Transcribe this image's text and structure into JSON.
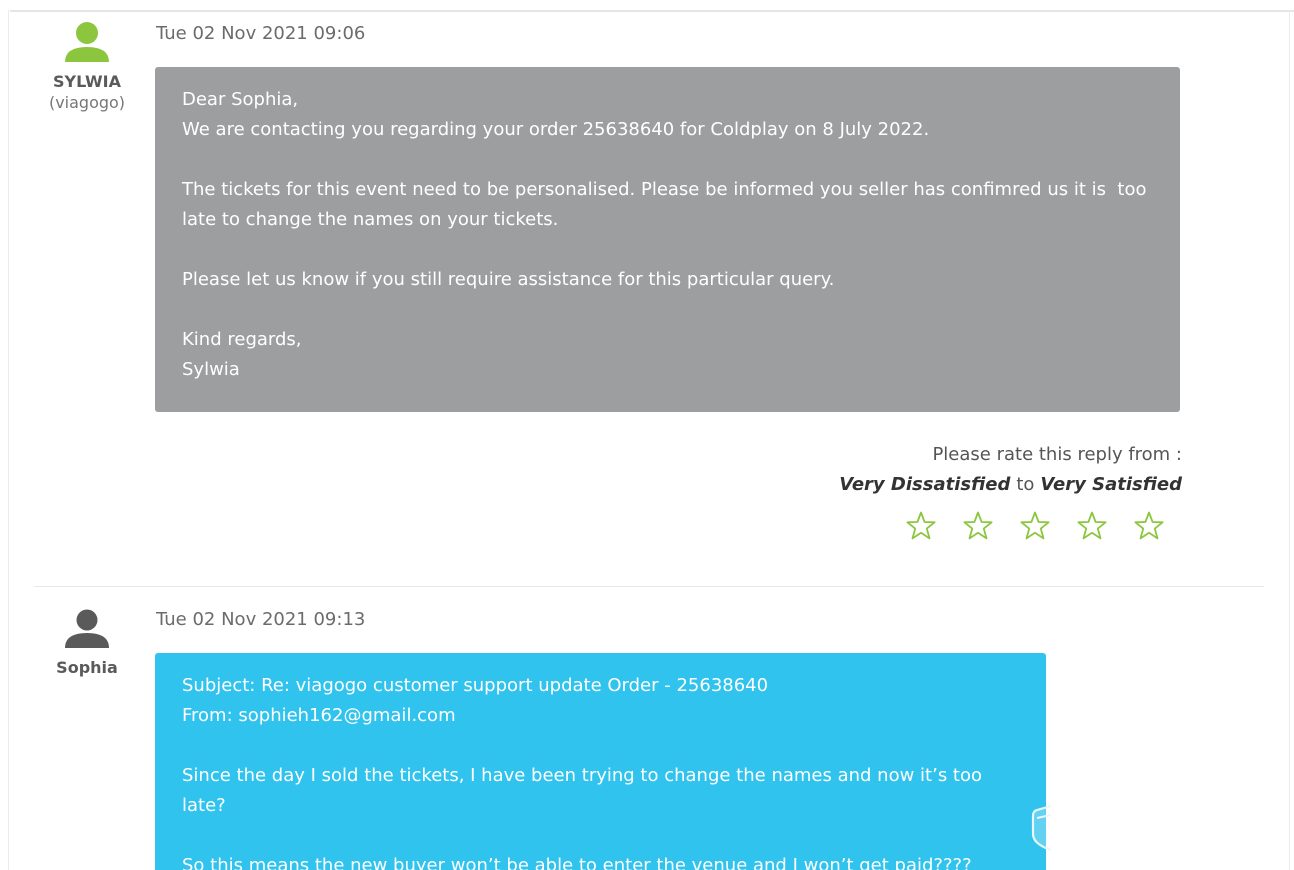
{
  "messages": [
    {
      "author": "SYLWIA",
      "org": "(viagogo)",
      "timestamp": "Tue 02 Nov 2021 09:06",
      "avatar_color": "#8cc63f",
      "bubble_color": "#9d9ea0",
      "body": [
        "Dear Sophia,\nWe are contacting you regarding your order 25638640 for Coldplay on 8 July 2022.",
        "The tickets for this event need to be personalised. Please be informed you seller has confimred us it is  too late to change the names on your tickets.",
        "Please let us know if you still require assistance for this particular query.",
        "Kind regards,\nSylwia"
      ]
    },
    {
      "author": "Sophia",
      "timestamp": "Tue 02 Nov 2021 09:13",
      "avatar_color": "#5a5a5a",
      "bubble_color": "#2fc3ee",
      "body": [
        "Subject: Re: viagogo customer support update Order - 25638640\nFrom: sophieh162@gmail.com",
        "Since the day I sold the tickets, I have been trying to change the names and now it’s too late?",
        "So this means the new buyer won’t be able to enter the venue and I won’t get paid????"
      ]
    }
  ],
  "rating": {
    "prompt": "Please rate this reply from :",
    "low_label": "Very Dissatisfied",
    "connector": "to",
    "high_label": "Very Satisfied",
    "star_count": 5,
    "star_color": "#8cc63f",
    "star_icon": "star-outline-icon"
  }
}
